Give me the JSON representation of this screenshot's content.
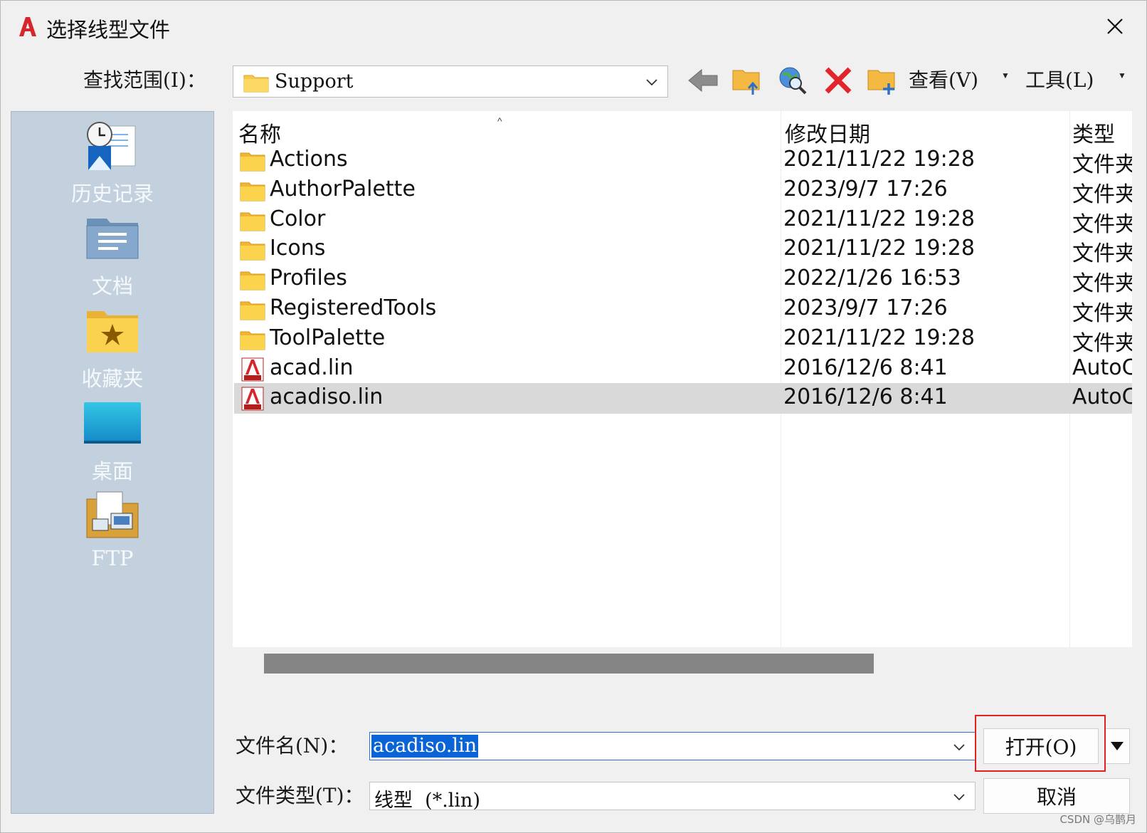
{
  "dialog": {
    "title": "选择线型文件"
  },
  "lookin": {
    "label": "查找范围(I)：",
    "value": "Support"
  },
  "toolbar": {
    "view_label": "查看(V)",
    "tools_label": "工具(L)"
  },
  "places": [
    {
      "label": "历史记录",
      "icon": "history-icon"
    },
    {
      "label": "文档",
      "icon": "documents-icon"
    },
    {
      "label": "收藏夹",
      "icon": "favorites-icon"
    },
    {
      "label": "桌面",
      "icon": "desktop-icon"
    },
    {
      "label": "FTP",
      "icon": "ftp-icon"
    }
  ],
  "files": {
    "headers": {
      "name": "名称",
      "date": "修改日期",
      "type": "类型"
    },
    "rows": [
      {
        "name": "Actions",
        "date": "2021/11/22 19:28",
        "type": "文件夹",
        "icon": "folder-icon"
      },
      {
        "name": "AuthorPalette",
        "date": "2023/9/7 17:26",
        "type": "文件夹",
        "icon": "folder-icon"
      },
      {
        "name": "Color",
        "date": "2021/11/22 19:28",
        "type": "文件夹",
        "icon": "folder-icon"
      },
      {
        "name": "Icons",
        "date": "2021/11/22 19:28",
        "type": "文件夹",
        "icon": "folder-icon"
      },
      {
        "name": "Profiles",
        "date": "2022/1/26 16:53",
        "type": "文件夹",
        "icon": "folder-icon"
      },
      {
        "name": "RegisteredTools",
        "date": "2023/9/7 17:26",
        "type": "文件夹",
        "icon": "folder-icon"
      },
      {
        "name": "ToolPalette",
        "date": "2021/11/22 19:28",
        "type": "文件夹",
        "icon": "folder-icon"
      },
      {
        "name": "acad.lin",
        "date": "2016/12/6 8:41",
        "type": "AutoCAD",
        "icon": "lin-file-icon"
      },
      {
        "name": "acadiso.lin",
        "date": "2016/12/6 8:41",
        "type": "AutoCAD",
        "icon": "lin-file-icon",
        "selected": true
      }
    ]
  },
  "filename": {
    "label": "文件名(N)：",
    "value": "acadiso.lin"
  },
  "filetype": {
    "label": "文件类型(T)：",
    "value": "线型  (*.lin)"
  },
  "buttons": {
    "open": "打开(O)",
    "cancel": "取消"
  },
  "watermark": "CSDN @乌鹊月",
  "colors": {
    "places_bg": "#c3d1de",
    "selection": "#0a64d6",
    "highlight_box": "#e02222",
    "app_red": "#d7262b"
  }
}
